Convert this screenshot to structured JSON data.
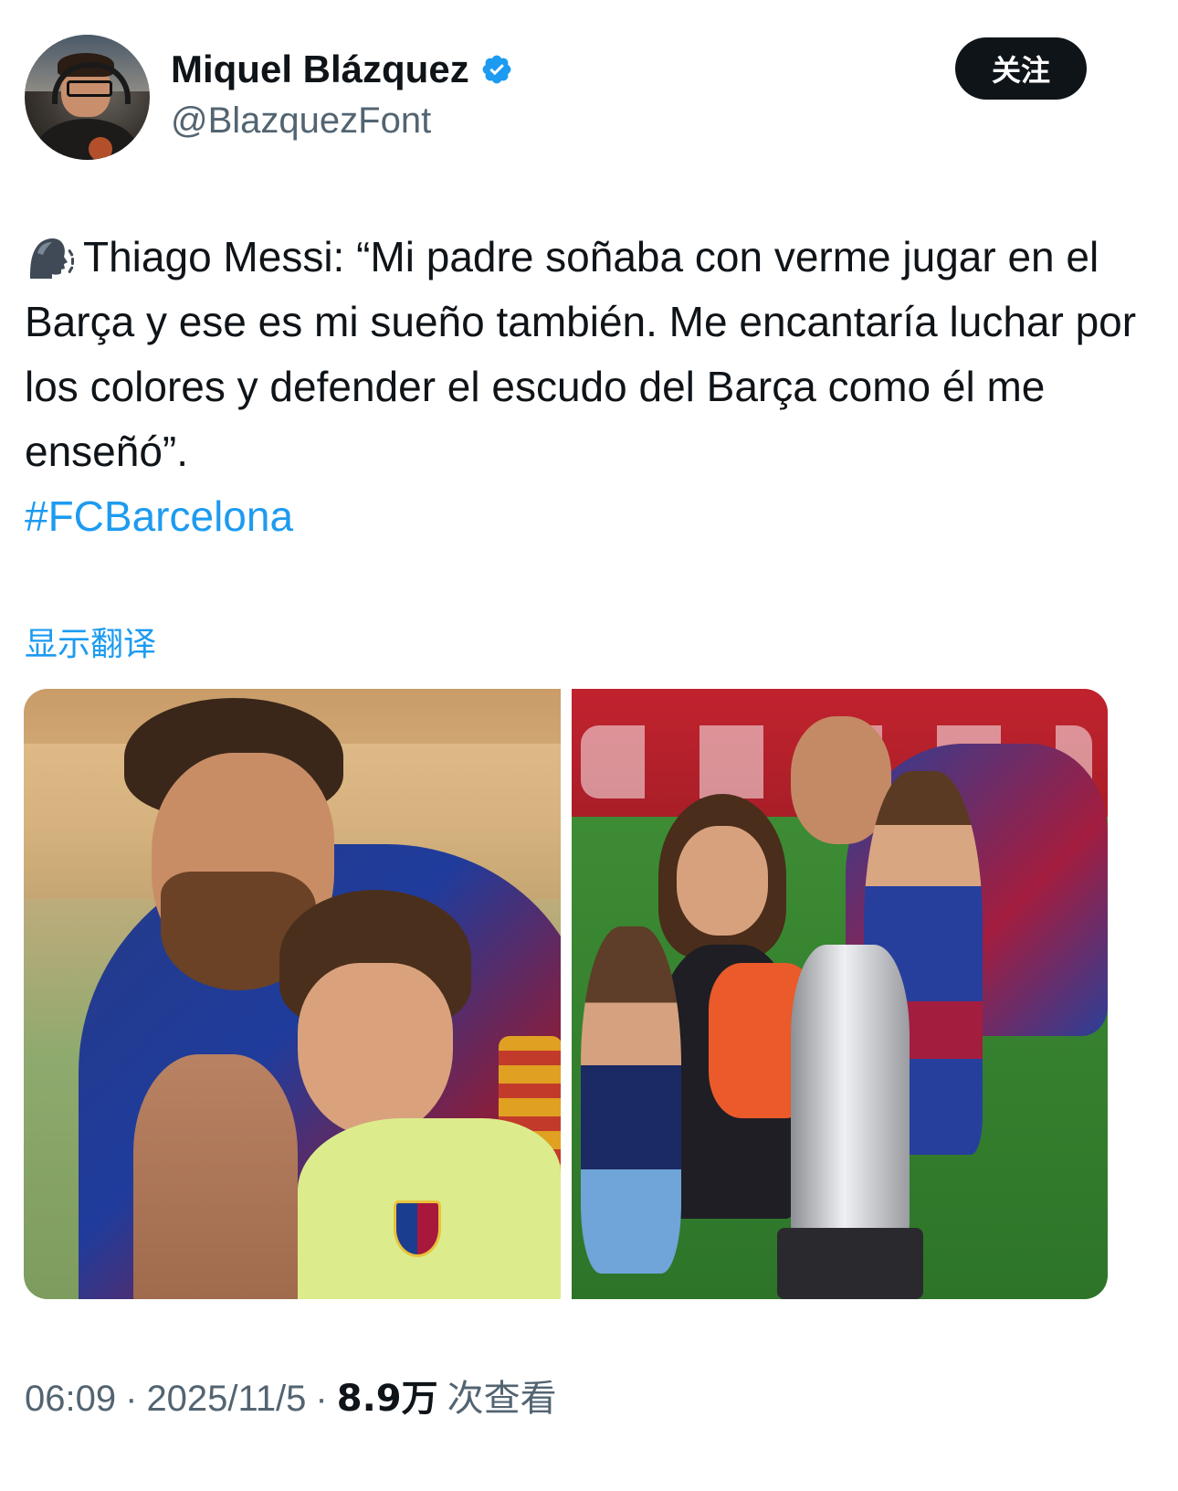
{
  "author": {
    "name": "Miquel Blázquez",
    "handle": "@BlazquezFont",
    "verified": true
  },
  "follow_label": "关注",
  "tweet": {
    "lead_icon": "speaking-head-icon",
    "body": "Thiago Messi: “Mi padre soñaba con verme jugar en el Barça y ese es mi sueño también. Me encantaría luchar por los colores y defender el escudo del Barça como él me enseñó”.",
    "hashtag": "#FCBarcelona"
  },
  "translate_label": "显示翻译",
  "meta": {
    "time": "06:09",
    "separator": "·",
    "date": "2025/11/5",
    "views_count": "8.9万",
    "views_label": "次查看"
  },
  "colors": {
    "accent": "#1d9bf0",
    "text": "#0f1419",
    "muted": "#536471"
  }
}
